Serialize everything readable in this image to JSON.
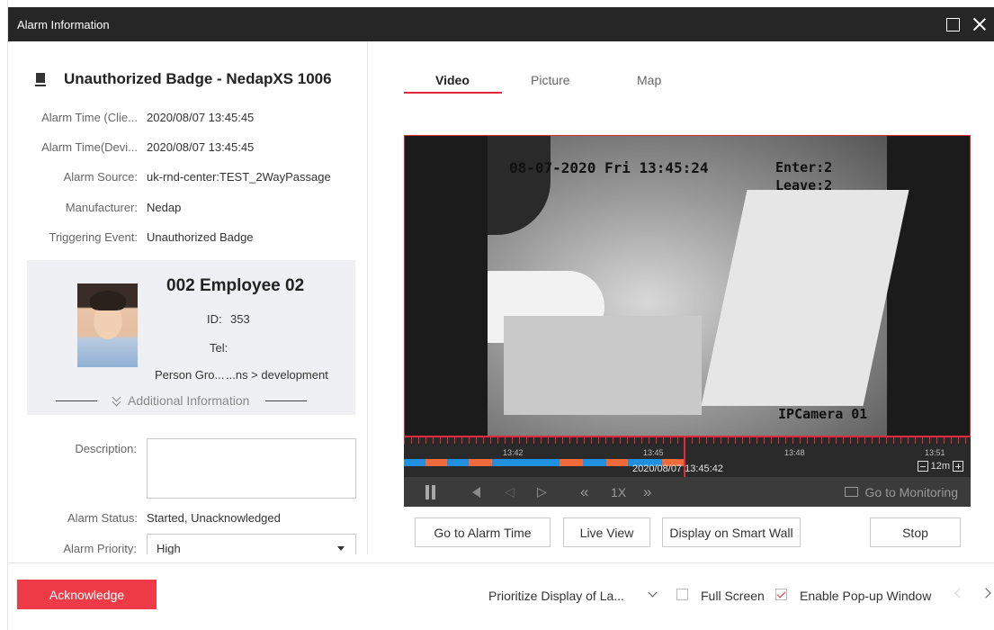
{
  "window": {
    "title": "Alarm Information"
  },
  "alarm": {
    "name": "Unauthorized Badge - NedapXS 1006",
    "fields": [
      {
        "label": "Alarm Time (Clie...",
        "value": "2020/08/07 13:45:45"
      },
      {
        "label": "Alarm Time(Devi...",
        "value": "2020/08/07 13:45:45"
      },
      {
        "label": "Alarm Source:",
        "value": "uk-rnd-center:TEST_2WayPassage"
      },
      {
        "label": "Manufacturer:",
        "value": "Nedap"
      },
      {
        "label": "Triggering Event:",
        "value": "Unauthorized Badge"
      }
    ]
  },
  "person": {
    "name": "002 Employee 02",
    "id_label": "ID:",
    "id_value": "353",
    "tel_label": "Tel:",
    "tel_value": "",
    "group_label": "Person Gro...",
    "group_value": "...ns > development",
    "additional_info": "Additional Information"
  },
  "form": {
    "description_label": "Description:",
    "description_value": "",
    "status_label": "Alarm Status:",
    "status_value": "Started, Unacknowledged",
    "priority_label": "Alarm Priority:",
    "priority_value": "High"
  },
  "tabs": [
    "Video",
    "Picture",
    "Map"
  ],
  "active_tab": "Video",
  "video": {
    "osd_datetime": "08-07-2020 Fri 13:45:24",
    "osd_enter": "Enter:2",
    "osd_leave": "Leave:2",
    "osd_camera": "IPCamera 01"
  },
  "timeline": {
    "labels": [
      "13:42",
      "13:45",
      "13:48",
      "13:51"
    ],
    "current_time": "2020/08/07 13:45:42",
    "zoom": "12m"
  },
  "playback": {
    "speed": "1X",
    "goto_monitoring": "Go to Monitoring"
  },
  "buttons": {
    "go_to_alarm_time": "Go to Alarm Time",
    "live_view": "Live View",
    "display_smart_wall": "Display on Smart Wall",
    "stop": "Stop"
  },
  "footer": {
    "acknowledge": "Acknowledge",
    "prioritize": "Prioritize Display of La...",
    "full_screen": "Full Screen",
    "full_screen_checked": false,
    "enable_popup": "Enable Pop-up Window",
    "enable_popup_checked": true
  },
  "colors": {
    "accent": "#e1293a",
    "titlebar": "#262626",
    "acknowledge": "#ef3b47",
    "timeline_blue": "#1f8fe0",
    "timeline_orange": "#f06a3a"
  }
}
